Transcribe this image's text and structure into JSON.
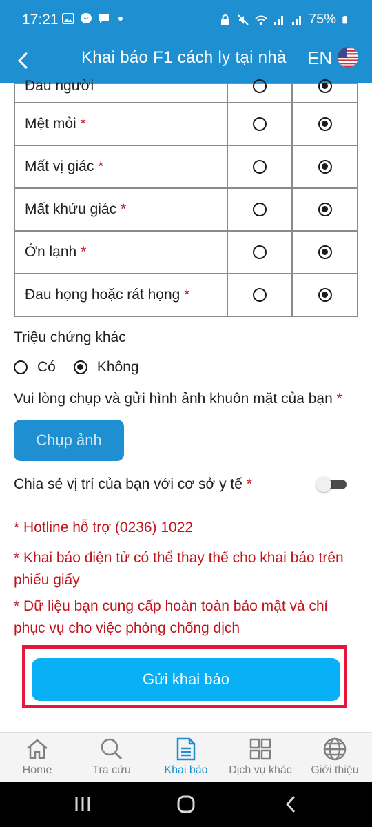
{
  "status_bar": {
    "time": "17:21",
    "battery": "75%"
  },
  "app_bar": {
    "title": "Khai báo F1 cách ly tại nhà",
    "language": "EN"
  },
  "symptom_table": {
    "partial_row": "Đau người",
    "rows": [
      {
        "label": "Mệt mỏi",
        "required": "*",
        "selected": "second"
      },
      {
        "label": "Mất vị giác",
        "required": "*",
        "selected": "second"
      },
      {
        "label": "Mất khứu giác",
        "required": "*",
        "selected": "second"
      },
      {
        "label": "Ớn lạnh",
        "required": "*",
        "selected": "second"
      },
      {
        "label": "Đau họng hoặc rát họng",
        "required": "*",
        "selected": "second"
      }
    ]
  },
  "other_symptoms": {
    "label": "Triệu chứng khác",
    "options": [
      "Có",
      "Không"
    ],
    "selected": "Không"
  },
  "photo": {
    "label": "Vui lòng chụp và gửi hình ảnh khuôn mặt của bạn",
    "required": "*",
    "button": "Chụp ảnh"
  },
  "location": {
    "label": "Chia sẻ vị trí của bạn với cơ sở y tế",
    "required": "*",
    "enabled": false
  },
  "notes": [
    "* Hotline hỗ trợ (0236) 1022",
    "* Khai báo điện tử có thể thay thế cho khai báo trên phiếu giấy",
    "* Dữ liệu bạn cung cấp hoàn toàn bảo mật và chỉ phục vụ cho việc phòng chống dịch"
  ],
  "submit": {
    "label": "Gửi khai báo"
  },
  "bottom_nav": {
    "items": [
      {
        "label": "Home",
        "icon": "home-icon",
        "active": false
      },
      {
        "label": "Tra cứu",
        "icon": "search-icon",
        "active": false
      },
      {
        "label": "Khai báo",
        "icon": "document-icon",
        "active": true
      },
      {
        "label": "Dịch vụ khác",
        "icon": "grid-icon",
        "active": false
      },
      {
        "label": "Giới thiệu",
        "icon": "globe-icon",
        "active": false
      }
    ]
  },
  "colors": {
    "primary": "#1e8fd0",
    "submit": "#08b0f5",
    "required": "#c0141d",
    "highlight_frame": "#e3193b"
  }
}
